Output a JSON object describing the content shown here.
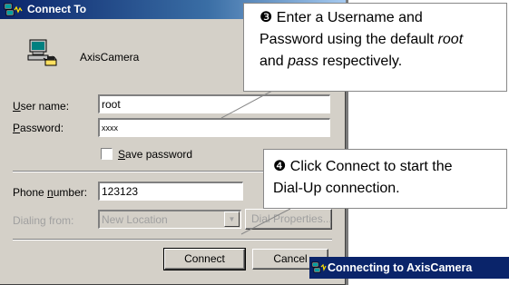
{
  "window": {
    "title": "Connect To",
    "entry_name": "AxisCamera"
  },
  "form": {
    "username_label_prefix": "U",
    "username_label_rest": "ser name:",
    "username_value": "root",
    "password_label_prefix": "P",
    "password_label_rest": "assword:",
    "password_value": "xxxx",
    "save_password_prefix": "S",
    "save_password_rest": "ave password",
    "save_password_checked": false,
    "phone_label_pre": "Phone ",
    "phone_label_u": "n",
    "phone_label_rest": "umber:",
    "phone_value": "123123",
    "dialing_label": "Dialing from:",
    "dialing_value": "New Location",
    "dialing_properties_label": "Dial Properties..."
  },
  "buttons": {
    "connect": "Connect",
    "cancel": "Cancel"
  },
  "callouts": {
    "step3_marker": "❸",
    "step3_line1": "Enter a Username and",
    "step3_line2": "Password using the default",
    "step3_word_root": "root",
    "step3_line3_mid": "and",
    "step3_word_pass": "pass",
    "step3_line3_end": "respectively.",
    "step4_marker": "❹",
    "step4_line1": "Click Connect to start the",
    "step4_line2": "Dial-Up connection."
  },
  "second_window": {
    "title": "Connecting to AxisCamera"
  },
  "colors": {
    "titlebar": "#0a246a",
    "face": "#d4d0c8"
  }
}
